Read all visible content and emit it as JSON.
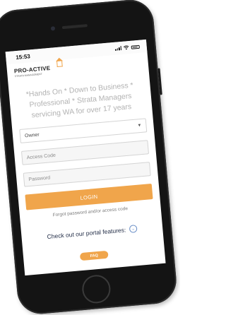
{
  "status_bar": {
    "time": "15:53"
  },
  "brand": {
    "name": "PRO-ACTIVE",
    "subtitle": "STRATA MANAGEMENT"
  },
  "tagline": "*Hands On * Down to Business * Professional * Strata Managers servicing WA for over 17 years",
  "login_form": {
    "role_select": {
      "value": "Owner",
      "options": [
        "Owner"
      ]
    },
    "access_code": {
      "placeholder": "Access Code"
    },
    "password": {
      "placeholder": "Password"
    },
    "login_label": "LOGIN",
    "forgot_link": "Forgot password and/or access code"
  },
  "features_link": "Check out our portal features:",
  "faq_label": "FAQ",
  "colors": {
    "accent": "#f0a54b",
    "tagline": "#b2b2b2",
    "link": "#1f2a44"
  },
  "icons": [
    "camera",
    "speaker",
    "signal-icon",
    "wifi-icon",
    "battery-icon",
    "house-logo-icon",
    "chevron-down-icon",
    "home-button"
  ]
}
